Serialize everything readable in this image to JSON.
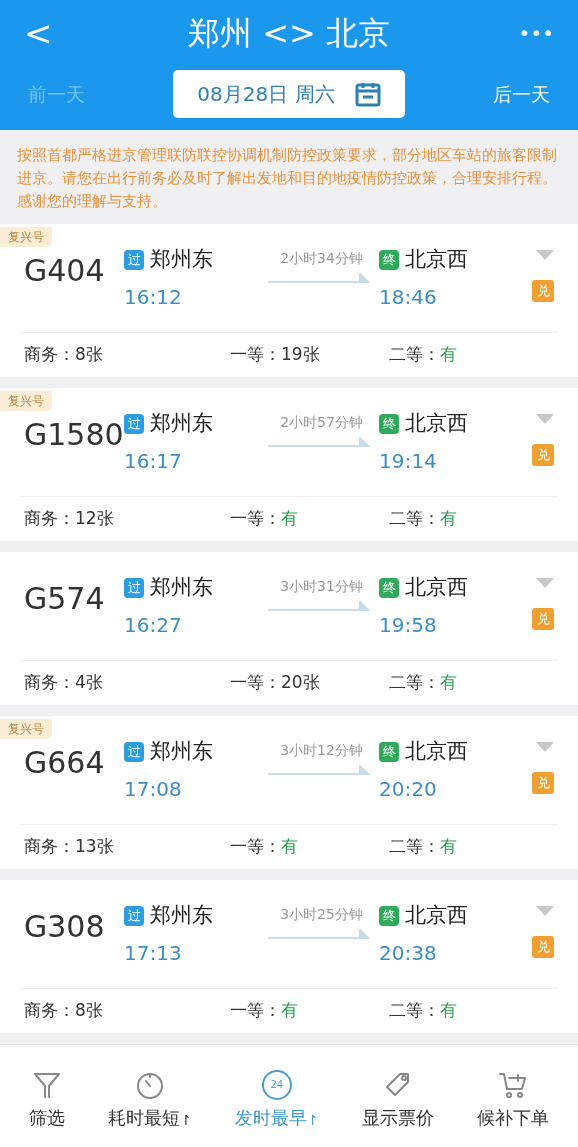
{
  "header": {
    "back": "<",
    "title": "郑州 <> 北京",
    "more": "•••"
  },
  "date_bar": {
    "prev": {
      "label": "前一天",
      "disabled": true
    },
    "date": "08月28日 周六",
    "next": {
      "label": "后一天",
      "disabled": false
    }
  },
  "notice": "按照首都严格进京管理联防联控协调机制防控政策要求，部分地区车站的旅客限制进京。请您在出行前务必及时了解出发地和目的地疫情防控政策，合理安排行程。感谢您的理解与支持。",
  "trains": [
    {
      "badge": "复兴号",
      "number": "G404",
      "from_tag": "过",
      "from": "郑州东",
      "depart": "16:12",
      "duration": "2小时34分钟",
      "to_tag": "终",
      "to": "北京西",
      "arrive": "18:46",
      "exchange": "兑",
      "seats": [
        {
          "label": "商务：",
          "value": "8张",
          "kind": "count"
        },
        {
          "label": "一等：",
          "value": "19张",
          "kind": "count"
        },
        {
          "label": "二等：",
          "value": "有",
          "kind": "plenty"
        }
      ]
    },
    {
      "badge": "复兴号",
      "number": "G1580",
      "from_tag": "过",
      "from": "郑州东",
      "depart": "16:17",
      "duration": "2小时57分钟",
      "to_tag": "终",
      "to": "北京西",
      "arrive": "19:14",
      "exchange": "兑",
      "seats": [
        {
          "label": "商务：",
          "value": "12张",
          "kind": "count"
        },
        {
          "label": "一等：",
          "value": "有",
          "kind": "plenty"
        },
        {
          "label": "二等：",
          "value": "有",
          "kind": "plenty"
        }
      ]
    },
    {
      "number": "G574",
      "from_tag": "过",
      "from": "郑州东",
      "depart": "16:27",
      "duration": "3小时31分钟",
      "to_tag": "终",
      "to": "北京西",
      "arrive": "19:58",
      "exchange": "兑",
      "seats": [
        {
          "label": "商务：",
          "value": "4张",
          "kind": "count"
        },
        {
          "label": "一等：",
          "value": "20张",
          "kind": "count"
        },
        {
          "label": "二等：",
          "value": "有",
          "kind": "plenty"
        }
      ]
    },
    {
      "badge": "复兴号",
      "number": "G664",
      "from_tag": "过",
      "from": "郑州东",
      "depart": "17:08",
      "duration": "3小时12分钟",
      "to_tag": "终",
      "to": "北京西",
      "arrive": "20:20",
      "exchange": "兑",
      "seats": [
        {
          "label": "商务：",
          "value": "13张",
          "kind": "count"
        },
        {
          "label": "一等：",
          "value": "有",
          "kind": "plenty"
        },
        {
          "label": "二等：",
          "value": "有",
          "kind": "plenty"
        }
      ]
    },
    {
      "number": "G308",
      "from_tag": "过",
      "from": "郑州东",
      "depart": "17:13",
      "duration": "3小时25分钟",
      "to_tag": "终",
      "to": "北京西",
      "arrive": "20:38",
      "exchange": "兑",
      "seats": [
        {
          "label": "商务：",
          "value": "8张",
          "kind": "count"
        },
        {
          "label": "一等：",
          "value": "有",
          "kind": "plenty"
        },
        {
          "label": "二等：",
          "value": "有",
          "kind": "plenty"
        }
      ]
    }
  ],
  "toolbar": [
    {
      "kind": "filter",
      "label": "筛选",
      "selected": false
    },
    {
      "kind": "timer",
      "label": "耗时最短",
      "sort_mark": "↾",
      "selected": false
    },
    {
      "kind": "clock",
      "label": "发时最早",
      "icon_text": "24",
      "sort_mark": "↾",
      "selected": true
    },
    {
      "kind": "tag",
      "label": "显示票价",
      "selected": false
    },
    {
      "kind": "cart",
      "label": "候补下单",
      "selected": false
    }
  ]
}
